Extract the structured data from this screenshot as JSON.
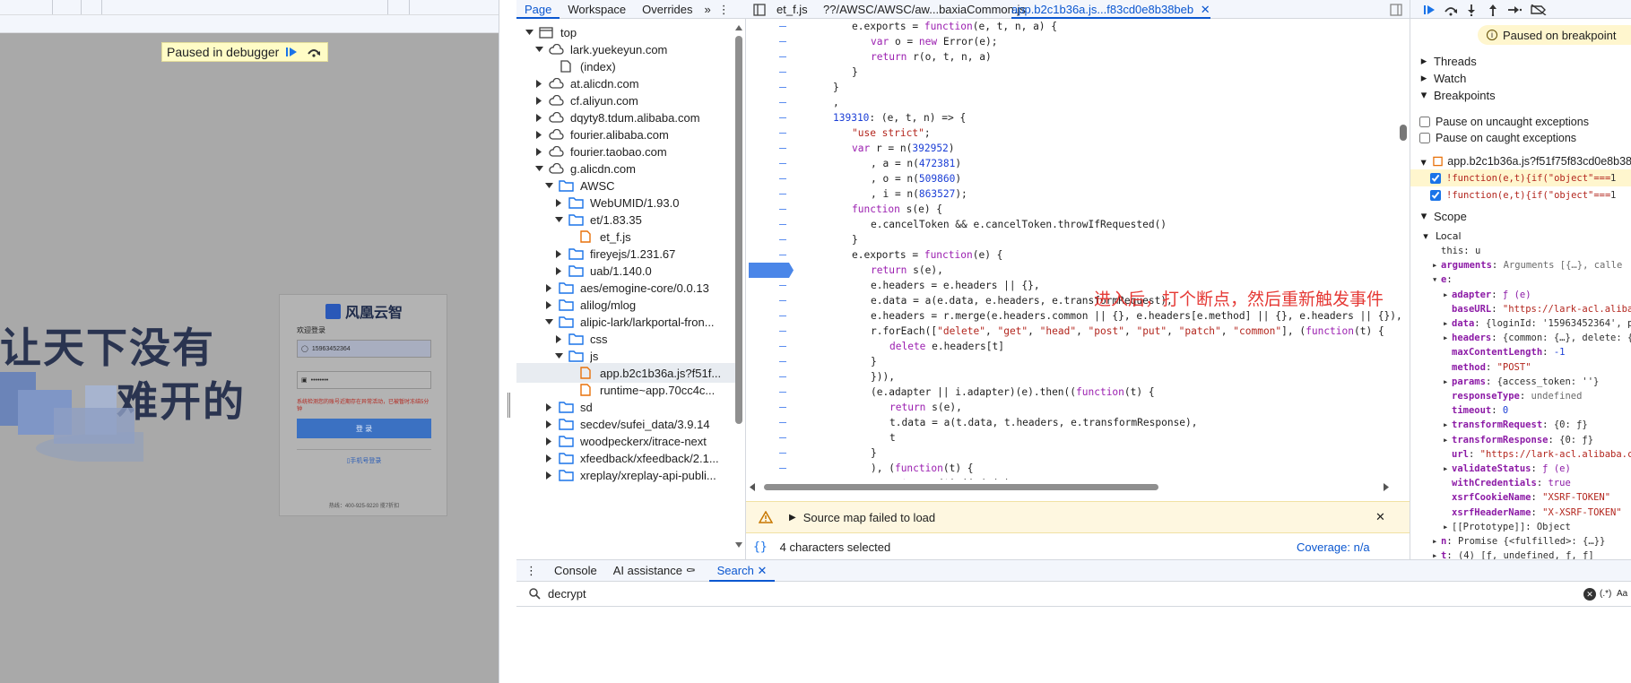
{
  "page": {
    "paused_label": "Paused in debugger",
    "big_text_line1": "让天下没有",
    "big_text_line2": "难开的",
    "login": {
      "brand": "风凰云智",
      "welcome": "欢迎登录",
      "username_value": "15963452364",
      "password_value": "••••••••",
      "error_text": "系统检测您的账号近期存在异常活动，已被暂时冻结5分钟",
      "submit_label": "登 录",
      "phone_login_link": "手机号登录",
      "footer": "热线：400-925-9220 揽7折扣"
    }
  },
  "navigator": {
    "tabs": [
      "Page",
      "Workspace",
      "Overrides"
    ],
    "items": [
      {
        "label": "top",
        "type": "frame",
        "depth": 0,
        "open": true
      },
      {
        "label": "lark.yuekeyun.com",
        "type": "cloud",
        "depth": 1,
        "open": true
      },
      {
        "label": "(index)",
        "type": "doc",
        "depth": 2,
        "open": null
      },
      {
        "label": "at.alicdn.com",
        "type": "cloud",
        "depth": 1,
        "open": false
      },
      {
        "label": "cf.aliyun.com",
        "type": "cloud",
        "depth": 1,
        "open": false
      },
      {
        "label": "dqyty8.tdum.alibaba.com",
        "type": "cloud",
        "depth": 1,
        "open": false
      },
      {
        "label": "fourier.alibaba.com",
        "type": "cloud",
        "depth": 1,
        "open": false
      },
      {
        "label": "fourier.taobao.com",
        "type": "cloud",
        "depth": 1,
        "open": false
      },
      {
        "label": "g.alicdn.com",
        "type": "cloud",
        "depth": 1,
        "open": true
      },
      {
        "label": "AWSC",
        "type": "folder",
        "depth": 2,
        "open": true
      },
      {
        "label": "WebUMID/1.93.0",
        "type": "folder",
        "depth": 3,
        "open": false
      },
      {
        "label": "et/1.83.35",
        "type": "folder",
        "depth": 3,
        "open": true
      },
      {
        "label": "et_f.js",
        "type": "file",
        "depth": 4,
        "open": null
      },
      {
        "label": "fireyejs/1.231.67",
        "type": "folder",
        "depth": 3,
        "open": false
      },
      {
        "label": "uab/1.140.0",
        "type": "folder",
        "depth": 3,
        "open": false
      },
      {
        "label": "aes/emogine-core/0.0.13",
        "type": "folder",
        "depth": 2,
        "open": false
      },
      {
        "label": "alilog/mlog",
        "type": "folder",
        "depth": 2,
        "open": false
      },
      {
        "label": "alipic-lark/larkportal-fron...",
        "type": "folder",
        "depth": 2,
        "open": true
      },
      {
        "label": "css",
        "type": "folder",
        "depth": 3,
        "open": false
      },
      {
        "label": "js",
        "type": "folder",
        "depth": 3,
        "open": true
      },
      {
        "label": "app.b2c1b36a.js?f51f...",
        "type": "file",
        "depth": 4,
        "open": null,
        "selected": true
      },
      {
        "label": "runtime~app.70cc4c...",
        "type": "file",
        "depth": 4,
        "open": null
      },
      {
        "label": "sd",
        "type": "folder",
        "depth": 2,
        "open": false
      },
      {
        "label": "secdev/sufei_data/3.9.14",
        "type": "folder",
        "depth": 2,
        "open": false
      },
      {
        "label": "woodpeckerx/itrace-next",
        "type": "folder",
        "depth": 2,
        "open": false
      },
      {
        "label": "xfeedback/xfeedback/2.1...",
        "type": "folder",
        "depth": 2,
        "open": false
      },
      {
        "label": "xreplay/xreplay-api-publi...",
        "type": "folder",
        "depth": 2,
        "open": false
      }
    ]
  },
  "editor": {
    "tabs": [
      {
        "label": "et_f.js",
        "active": false
      },
      {
        "label": "??/AWSC/AWSC/aw...baxiaCommon.js",
        "active": false
      },
      {
        "label": "app.b2c1b36a.js...f83cd0e8b38beb",
        "active": true
      }
    ],
    "annotation": "进入后，打个断点，然后重新触发事件",
    "source_map_warning": "Source map failed to load",
    "selection_status": "4 characters selected",
    "coverage": "Coverage: n/a",
    "lines": [
      {
        "indent": 3,
        "tokens": [
          [
            "p",
            "e.exports = "
          ],
          [
            "kw",
            "function"
          ],
          [
            "p",
            "(e, t, n, a) {"
          ]
        ]
      },
      {
        "indent": 4,
        "tokens": [
          [
            "kw",
            "var"
          ],
          [
            "p",
            " o = "
          ],
          [
            "kw",
            "new"
          ],
          [
            "p",
            " Error(e);"
          ]
        ]
      },
      {
        "indent": 4,
        "tokens": [
          [
            "kw",
            "return"
          ],
          [
            "p",
            " r(o, t, n, a)"
          ]
        ]
      },
      {
        "indent": 3,
        "tokens": [
          [
            "p",
            "}"
          ]
        ]
      },
      {
        "indent": 2,
        "tokens": [
          [
            "p",
            "}"
          ]
        ]
      },
      {
        "indent": 2,
        "tokens": [
          [
            "p",
            ","
          ]
        ]
      },
      {
        "indent": 2,
        "tokens": [
          [
            "num",
            "139310"
          ],
          [
            "p",
            ": (e, t, n) => {"
          ]
        ]
      },
      {
        "indent": 3,
        "tokens": [
          [
            "str",
            "\"use strict\""
          ],
          [
            "p",
            ";"
          ]
        ]
      },
      {
        "indent": 3,
        "tokens": [
          [
            "kw",
            "var"
          ],
          [
            "p",
            " r = n("
          ],
          [
            "num",
            "392952"
          ],
          [
            "p",
            ")"
          ]
        ]
      },
      {
        "indent": 4,
        "tokens": [
          [
            "p",
            ", a = n("
          ],
          [
            "num",
            "472381"
          ],
          [
            "p",
            ")"
          ]
        ]
      },
      {
        "indent": 4,
        "tokens": [
          [
            "p",
            ", o = n("
          ],
          [
            "num",
            "509860"
          ],
          [
            "p",
            ")"
          ]
        ]
      },
      {
        "indent": 4,
        "tokens": [
          [
            "p",
            ", i = n("
          ],
          [
            "num",
            "863527"
          ],
          [
            "p",
            ");"
          ]
        ]
      },
      {
        "indent": 3,
        "tokens": [
          [
            "kw",
            "function"
          ],
          [
            "p",
            " s(e) {"
          ]
        ]
      },
      {
        "indent": 4,
        "tokens": [
          [
            "p",
            "e.cancelToken && e.cancelToken.throwIfRequested()"
          ]
        ]
      },
      {
        "indent": 3,
        "tokens": [
          [
            "p",
            "}"
          ]
        ]
      },
      {
        "indent": 3,
        "tokens": [
          [
            "p",
            "e.exports = "
          ],
          [
            "kw",
            "function"
          ],
          [
            "p",
            "(e) {"
          ]
        ]
      },
      {
        "indent": 4,
        "tokens": [
          [
            "kw",
            "return"
          ],
          [
            "p",
            " s(e),"
          ]
        ]
      },
      {
        "indent": 4,
        "tokens": [
          [
            "p",
            "e.headers = e.headers || {},"
          ]
        ]
      },
      {
        "indent": 4,
        "tokens": [
          [
            "p",
            "e.data = a(e.data, e.headers, e.transformRequest),"
          ]
        ]
      },
      {
        "indent": 4,
        "tokens": [
          [
            "p",
            "e.headers = r.merge(e.headers.common || {}, e.headers[e.method] || {}, e.headers || {}),"
          ]
        ]
      },
      {
        "indent": 4,
        "tokens": [
          [
            "p",
            "r.forEach(["
          ],
          [
            "str",
            "\"delete\""
          ],
          [
            "p",
            ", "
          ],
          [
            "str",
            "\"get\""
          ],
          [
            "p",
            ", "
          ],
          [
            "str",
            "\"head\""
          ],
          [
            "p",
            ", "
          ],
          [
            "str",
            "\"post\""
          ],
          [
            "p",
            ", "
          ],
          [
            "str",
            "\"put\""
          ],
          [
            "p",
            ", "
          ],
          [
            "str",
            "\"patch\""
          ],
          [
            "p",
            ", "
          ],
          [
            "str",
            "\"common\""
          ],
          [
            "p",
            "], ("
          ],
          [
            "kw",
            "function"
          ],
          [
            "p",
            "(t) {"
          ]
        ]
      },
      {
        "indent": 5,
        "tokens": [
          [
            "kw",
            "delete"
          ],
          [
            "p",
            " e.headers[t]"
          ]
        ]
      },
      {
        "indent": 4,
        "tokens": [
          [
            "p",
            "}"
          ]
        ]
      },
      {
        "indent": 4,
        "tokens": [
          [
            "p",
            "})),"
          ]
        ]
      },
      {
        "indent": 4,
        "tokens": [
          [
            "p",
            "(e.adapter || i.adapter)(e).then(("
          ],
          [
            "kw",
            "function"
          ],
          [
            "p",
            "(t) {"
          ]
        ]
      },
      {
        "indent": 5,
        "tokens": [
          [
            "kw",
            "return"
          ],
          [
            "p",
            " s(e),"
          ]
        ]
      },
      {
        "indent": 5,
        "tokens": [
          [
            "p",
            "t.data = a(t.data, t.headers, e.transformResponse),"
          ]
        ]
      },
      {
        "indent": 5,
        "tokens": [
          [
            "p",
            "t"
          ]
        ]
      },
      {
        "indent": 4,
        "tokens": [
          [
            "p",
            "}"
          ]
        ]
      },
      {
        "indent": 4,
        "tokens": [
          [
            "p",
            "), ("
          ],
          [
            "kw",
            "function"
          ],
          [
            "p",
            "(t) {"
          ]
        ]
      },
      {
        "indent": 5,
        "tokens": [
          [
            "kw",
            "return"
          ],
          [
            "p",
            " o(t) || (s(e),"
          ]
        ]
      }
    ]
  },
  "debugger": {
    "paused_banner": "Paused on breakpoint",
    "threads": "Threads",
    "watch": "Watch",
    "breakpoints": "Breakpoints",
    "pause_uncaught": "Pause on uncaught exceptions",
    "pause_caught": "Pause on caught exceptions",
    "bp_file": "app.b2c1b36a.js?f51f75f83cd0e8b38",
    "bp_items": [
      "!function(e,t){if(\"object\"===",
      "!function(e,t){if(\"object\"==="
    ],
    "bp_counts": [
      "1",
      "1"
    ],
    "scope": "Scope",
    "local": "Local",
    "scope_vars": [
      {
        "indent": 1,
        "tw": "",
        "key": "this",
        "val": "u",
        "vt": "obj",
        "bold": false
      },
      {
        "indent": 1,
        "tw": "▸",
        "key": "arguments",
        "val": "Arguments  [{…}, calle",
        "vt": "gray",
        "bold": true
      },
      {
        "indent": 1,
        "tw": "▾",
        "key": "e",
        "val": "",
        "vt": "obj",
        "bold": true
      },
      {
        "indent": 2,
        "tw": "▸",
        "key": "adapter",
        "val": "ƒ (e)",
        "vt": "kw",
        "bold": true
      },
      {
        "indent": 2,
        "tw": "",
        "key": "baseURL",
        "val": "\"https://lark-acl.alibab",
        "vt": "str",
        "bold": true
      },
      {
        "indent": 2,
        "tw": "▸",
        "key": "data",
        "val": "{loginId: '15963452364', pas",
        "vt": "obj",
        "bold": true
      },
      {
        "indent": 2,
        "tw": "▸",
        "key": "headers",
        "val": "{common: {…}, delete: {",
        "vt": "obj",
        "bold": true
      },
      {
        "indent": 2,
        "tw": "",
        "key": "maxContentLength",
        "val": "-1",
        "vt": "num",
        "bold": true
      },
      {
        "indent": 2,
        "tw": "",
        "key": "method",
        "val": "\"POST\"",
        "vt": "str",
        "bold": true
      },
      {
        "indent": 2,
        "tw": "▸",
        "key": "params",
        "val": "{access_token: ''}",
        "vt": "obj",
        "bold": true
      },
      {
        "indent": 2,
        "tw": "",
        "key": "responseType",
        "val": "undefined",
        "vt": "gray",
        "bold": true
      },
      {
        "indent": 2,
        "tw": "",
        "key": "timeout",
        "val": "0",
        "vt": "num",
        "bold": true
      },
      {
        "indent": 2,
        "tw": "▸",
        "key": "transformRequest",
        "val": "{0: ƒ}",
        "vt": "obj",
        "bold": true
      },
      {
        "indent": 2,
        "tw": "▸",
        "key": "transformResponse",
        "val": "{0: ƒ}",
        "vt": "obj",
        "bold": true
      },
      {
        "indent": 2,
        "tw": "",
        "key": "url",
        "val": "\"https://lark-acl.alibaba.com",
        "vt": "str",
        "bold": true
      },
      {
        "indent": 2,
        "tw": "▸",
        "key": "validateStatus",
        "val": "ƒ (e)",
        "vt": "kw",
        "bold": true
      },
      {
        "indent": 2,
        "tw": "",
        "key": "withCredentials",
        "val": "true",
        "vt": "kw",
        "bold": true
      },
      {
        "indent": 2,
        "tw": "",
        "key": "xsrfCookieName",
        "val": "\"XSRF-TOKEN\"",
        "vt": "str",
        "bold": true
      },
      {
        "indent": 2,
        "tw": "",
        "key": "xsrfHeaderName",
        "val": "\"X-XSRF-TOKEN\"",
        "vt": "str",
        "bold": true
      },
      {
        "indent": 2,
        "tw": "▸",
        "key": "[[Prototype]]",
        "val": "Object",
        "vt": "obj",
        "bold": false
      },
      {
        "indent": 1,
        "tw": "▸",
        "key": "n",
        "val": "Promise  {<fulfilled>: {…}}",
        "vt": "obj",
        "bold": true
      },
      {
        "indent": 1,
        "tw": "▸",
        "key": "t",
        "val": "(4)  [ƒ, undefined, ƒ, ƒ]",
        "vt": "obj",
        "bold": true
      }
    ]
  },
  "drawer": {
    "tabs": [
      "Console",
      "AI assistance",
      "Search"
    ],
    "active_tab": "Search",
    "search_value": "decrypt",
    "regex_label": "(.*)",
    "case_label": "Aa"
  }
}
